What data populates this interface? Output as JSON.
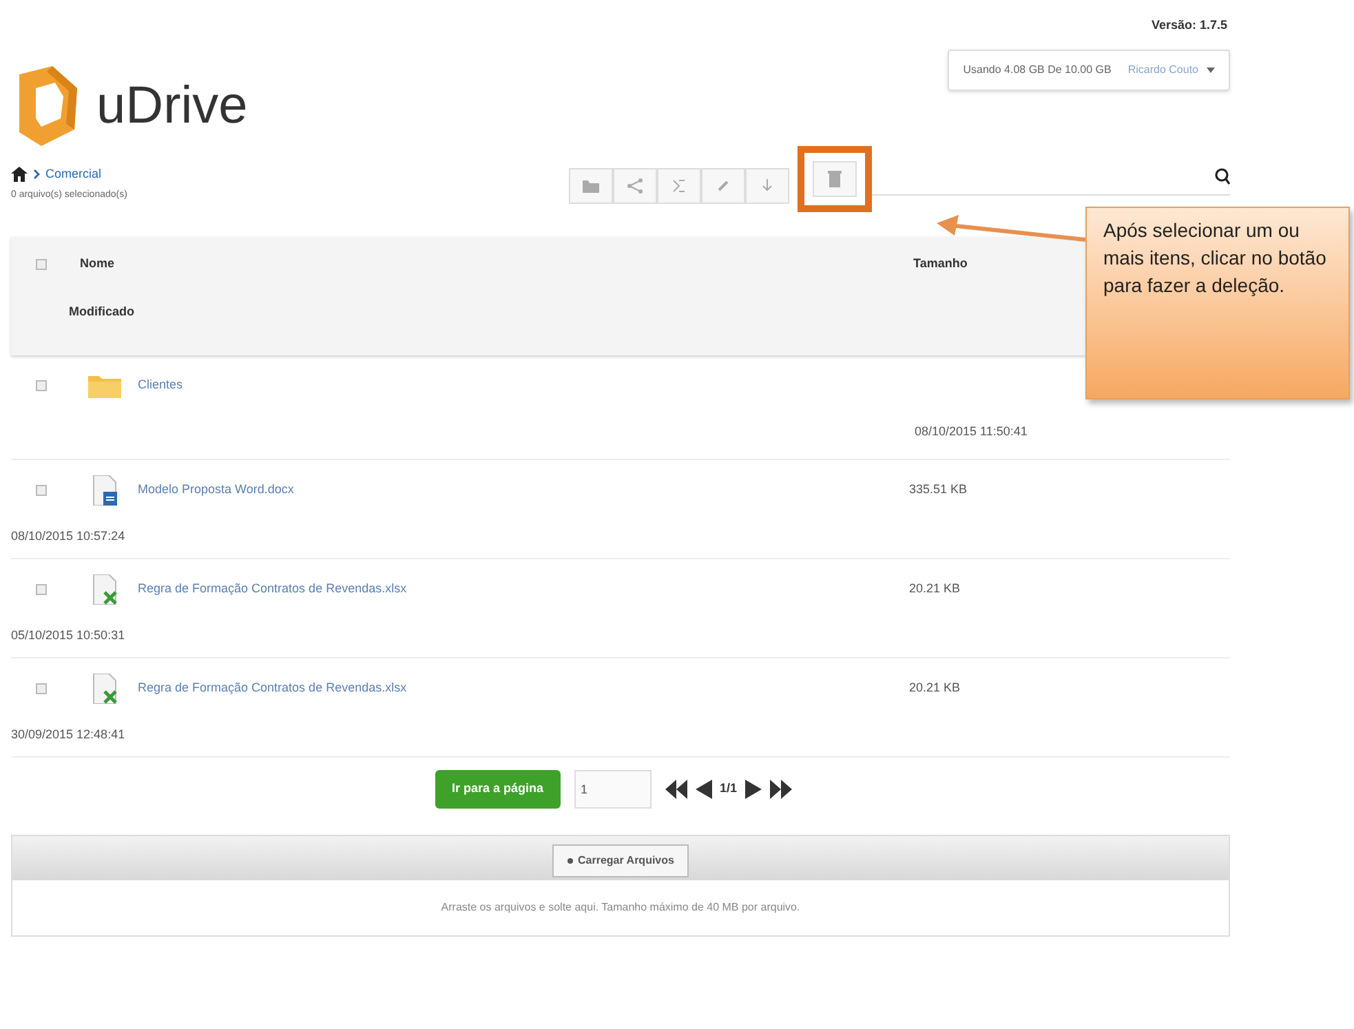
{
  "version": "Versão: 1.7.5",
  "account": {
    "storage": "Usando 4.08 GB De 10.00 GB",
    "user": "Ricardo Couto"
  },
  "logo": {
    "text": "uDrive"
  },
  "breadcrumb": {
    "current": "Comercial",
    "selection": "0 arquivo(s) selecionado(s)"
  },
  "toolbar": [
    {
      "kind": "folder",
      "highlighted": false
    },
    {
      "kind": "share",
      "highlighted": false
    },
    {
      "kind": "move",
      "highlighted": false
    },
    {
      "kind": "link",
      "highlighted": false
    },
    {
      "kind": "download",
      "highlighted": false
    },
    {
      "kind": "trash",
      "highlighted": true
    }
  ],
  "callout": {
    "text": "Após selecionar um ou mais itens, clicar no botão para fazer a deleção."
  },
  "table": {
    "header_checked": false,
    "columns": [
      "Nome",
      "Tamanho",
      "Modificado"
    ],
    "rows": [
      {
        "kind": "folder",
        "checked": false,
        "name": "Clientes",
        "size_column_text": "08/10/2015 11:50:41"
      },
      {
        "kind": "word",
        "checked": false,
        "name": "Modelo Proposta Word.docx",
        "size": "335.51 KB",
        "modified": "08/10/2015 10:57:24"
      },
      {
        "kind": "excel",
        "checked": false,
        "name": "Regra de Formação Contratos de Revendas.xlsx",
        "size": "20.21 KB",
        "modified": "05/10/2015 10:50:31"
      },
      {
        "kind": "excel",
        "checked": false,
        "name": "Regra de Formação Contratos de Revendas.xlsx",
        "size": "20.21 KB",
        "modified": "30/09/2015 12:48:41"
      }
    ]
  },
  "pagination": {
    "button": "Ir para a página",
    "page_value": "1",
    "page_label": "1/1"
  },
  "upload": {
    "button": "Carregar Arquivos",
    "hint": "Arraste os arquivos e solte aqui. Tamanho máximo de 40 MB por arquivo."
  }
}
